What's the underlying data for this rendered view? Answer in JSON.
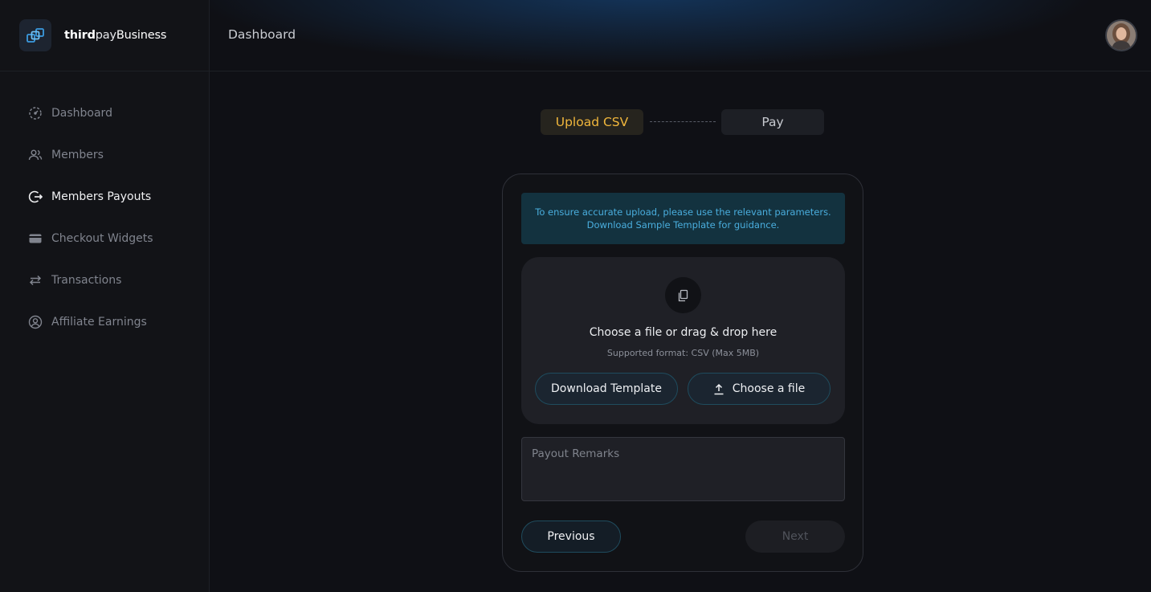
{
  "brand": {
    "name_part1": "third",
    "name_part2": "pay",
    "name_part3": "Business",
    "logo_icon": "link-cubes-icon",
    "accent_color": "#3b9be0"
  },
  "header": {
    "title": "Dashboard",
    "avatar_icon": "user-avatar"
  },
  "sidebar": {
    "items": [
      {
        "label": "Dashboard",
        "icon": "dashboard-gauge-icon",
        "active": false
      },
      {
        "label": "Members",
        "icon": "users-icon",
        "active": false
      },
      {
        "label": "Members Payouts",
        "icon": "payout-refresh-icon",
        "active": true
      },
      {
        "label": "Checkout Widgets",
        "icon": "card-icon",
        "active": false
      },
      {
        "label": "Transactions",
        "icon": "arrows-swap-icon",
        "active": false
      },
      {
        "label": "Affiliate Earnings",
        "icon": "user-circle-icon",
        "active": false
      }
    ]
  },
  "stepper": {
    "steps": [
      {
        "label": "Upload CSV",
        "active": true
      },
      {
        "label": "Pay",
        "active": false
      }
    ],
    "active_color": "#f1b73c"
  },
  "upload": {
    "notice_line1": "To ensure accurate upload, please use the relevant parameters.",
    "notice_line2": "Download Sample Template for guidance.",
    "drop_title": "Choose a file or drag & drop here",
    "drop_subtitle": "Supported format: CSV (Max 5MB)",
    "download_template_label": "Download Template",
    "choose_file_label": "Choose a file",
    "remarks_placeholder": "Payout Remarks",
    "remarks_value": ""
  },
  "actions": {
    "previous_label": "Previous",
    "next_label": "Next",
    "next_disabled": true
  }
}
